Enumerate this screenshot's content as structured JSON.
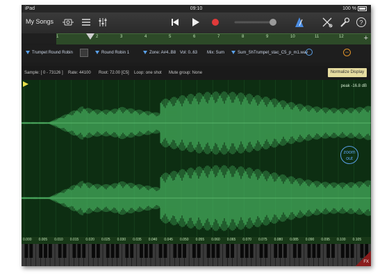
{
  "status": {
    "device": "iPad",
    "time": "09:10",
    "battery": "100 %"
  },
  "toolbar": {
    "my_songs": "My Songs"
  },
  "ruler": {
    "numbers": [
      "1",
      "2",
      "3",
      "4",
      "5",
      "6",
      "7",
      "8",
      "9",
      "10",
      "11",
      "12"
    ]
  },
  "zone_bar": {
    "instrument": "Trumpet Round Robin",
    "round_robin": "Round Robin 1",
    "zone": "Zone: A#4..B8",
    "vol": "Vol: 0..63",
    "mix": "Mix: Sum",
    "sample_file": "Sum_ShTrumpet_stac_C5_p_m1.wav"
  },
  "info": {
    "sample": "Sample: [ 0 - 73126 ]",
    "rate": "Rate: 44100",
    "root": "Root: 72.00 [C5]",
    "loop": "Loop: one shot",
    "mute": "Mute group: None",
    "normalize": "Normalize Display"
  },
  "waveform": {
    "peak": "peak -16.8 dB",
    "zoom_out": "zoom out"
  },
  "timeline": {
    "labels": [
      "0.000",
      "0.005",
      "0.010",
      "0.015",
      "0.020",
      "0.025",
      "0.030",
      "0.035",
      "0.040",
      "0.045",
      "0.050",
      "0.055",
      "0.060",
      "0.065",
      "0.070",
      "0.075",
      "0.080",
      "0.085",
      "0.090",
      "0.095",
      "0.100",
      "0.105"
    ]
  },
  "fx": {
    "label": "FX"
  },
  "colors": {
    "wave": "#4fc46a",
    "background": "#0d2e12",
    "accent": "#5aa0e8",
    "record": "#e03a3a"
  }
}
